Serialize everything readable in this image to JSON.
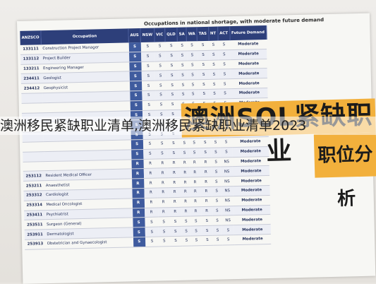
{
  "caption": "Occupations in national shortage, with moderate future demand",
  "columns": [
    "ANZSCO",
    "Occupation",
    "AUS",
    "NSW",
    "VIC",
    "QLD",
    "SA",
    "WA",
    "TAS",
    "NT",
    "ACT",
    "Future Demand"
  ],
  "rows": [
    {
      "code": "133111",
      "occ": "Construction Project Manager",
      "v": [
        "S",
        "S",
        "S",
        "S",
        "S",
        "S",
        "S",
        "S",
        "S"
      ],
      "fut": "Moderate"
    },
    {
      "code": "133112",
      "occ": "Project Builder",
      "v": [
        "S",
        "S",
        "S",
        "S",
        "S",
        "S",
        "S",
        "S",
        "S"
      ],
      "fut": "Moderate"
    },
    {
      "code": "133211",
      "occ": "Engineering Manager",
      "v": [
        "S",
        "S",
        "S",
        "S",
        "S",
        "S",
        "S",
        "S",
        "S"
      ],
      "fut": "Moderate"
    },
    {
      "code": "234411",
      "occ": "Geologist",
      "v": [
        "S",
        "S",
        "S",
        "S",
        "S",
        "S",
        "S",
        "S",
        "S"
      ],
      "fut": "Moderate"
    },
    {
      "code": "234412",
      "occ": "Geophysicist",
      "v": [
        "S",
        "S",
        "S",
        "S",
        "S",
        "S",
        "S",
        "S",
        "S"
      ],
      "fut": "Moderate"
    },
    {
      "code": "",
      "occ": "",
      "v": [
        "S",
        "S",
        "S",
        "S",
        "S",
        "S",
        "S",
        "S",
        "S"
      ],
      "fut": "Moderate"
    },
    {
      "code": "",
      "occ": "",
      "v": [
        "S",
        "S",
        "S",
        "S",
        "S",
        "S",
        "S",
        "S",
        "S"
      ],
      "fut": "Moderate"
    },
    {
      "code": "",
      "occ": "",
      "v": [
        "S",
        "S",
        "S",
        "S",
        "S",
        "S",
        "S",
        "S",
        "S"
      ],
      "fut": "Moderate"
    },
    {
      "code": "",
      "occ": "",
      "v": [
        "S",
        "S",
        "S",
        "S",
        "S",
        "S",
        "S",
        "S",
        "S"
      ],
      "fut": "Moderate"
    },
    {
      "code": "",
      "occ": "",
      "v": [
        "S",
        "S",
        "S",
        "S",
        "S",
        "S",
        "S",
        "S",
        "S"
      ],
      "fut": "Moderate"
    },
    {
      "code": "",
      "occ": "",
      "v": [
        "S",
        "S",
        "S",
        "S",
        "S",
        "S",
        "S",
        "S",
        "S"
      ],
      "fut": "Moderate"
    },
    {
      "code": "",
      "occ": "",
      "v": [
        "S",
        "S",
        "S",
        "S",
        "S",
        "S",
        "S",
        "S",
        "S"
      ],
      "fut": "Moderate"
    },
    {
      "code": "",
      "occ": "",
      "v": [
        "R",
        "R",
        "R",
        "R",
        "R",
        "R",
        "R",
        "S",
        "NS"
      ],
      "fut": "Moderate"
    },
    {
      "code": "253112",
      "occ": "Resident Medical Officer",
      "v": [
        "R",
        "R",
        "R",
        "R",
        "R",
        "R",
        "R",
        "S",
        "NS"
      ],
      "fut": "Moderate"
    },
    {
      "code": "253211",
      "occ": "Anaesthetist",
      "v": [
        "R",
        "R",
        "R",
        "R",
        "R",
        "R",
        "R",
        "S",
        "NS"
      ],
      "fut": "Moderate"
    },
    {
      "code": "253312",
      "occ": "Cardiologist",
      "v": [
        "R",
        "R",
        "R",
        "R",
        "R",
        "R",
        "R",
        "S",
        "NS"
      ],
      "fut": "Moderate"
    },
    {
      "code": "253314",
      "occ": "Medical Oncologist",
      "v": [
        "R",
        "R",
        "R",
        "R",
        "R",
        "R",
        "R",
        "S",
        "NS"
      ],
      "fut": "Moderate"
    },
    {
      "code": "253411",
      "occ": "Psychiatrist",
      "v": [
        "R",
        "R",
        "R",
        "R",
        "R",
        "R",
        "R",
        "S",
        "NS"
      ],
      "fut": "Moderate"
    },
    {
      "code": "253511",
      "occ": "Surgeon (General)",
      "v": [
        "S",
        "S",
        "S",
        "S",
        "S",
        "S",
        "S",
        "S",
        "NS"
      ],
      "fut": "Moderate"
    },
    {
      "code": "253911",
      "occ": "Dermatologist",
      "v": [
        "S",
        "S",
        "S",
        "S",
        "S",
        "S",
        "S",
        "S",
        "S"
      ],
      "fut": "Moderate"
    },
    {
      "code": "253913",
      "occ": "Obstetrician and Gynaecologist",
      "v": [
        "S",
        "S",
        "S",
        "S",
        "S",
        "S",
        "S",
        "S",
        "S"
      ],
      "fut": "Moderate"
    }
  ],
  "stamp": {
    "top": "澳洲SOL紧缺职业",
    "bottom": "职位分析"
  },
  "overlay_title": "澳洲移民紧缺职业清单,澳洲移民紧缺职业清单2023"
}
